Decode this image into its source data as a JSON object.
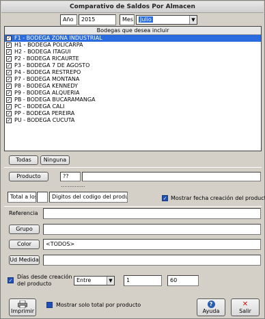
{
  "window": {
    "title": "Comparativo de Saldos Por Almacen"
  },
  "period": {
    "year_label": "Año",
    "year_value": "2015",
    "month_label": "Mes",
    "month_value": "Julio"
  },
  "warehouses": {
    "header": "Bodegas que desea incluir",
    "items": [
      {
        "label": "F1 - BODEGA ZONA INDUSTRIAL",
        "checked": true,
        "selected": true
      },
      {
        "label": "H1 - BODEGA POLICARPA",
        "checked": true
      },
      {
        "label": "H2 - BODEGA ITAGUI",
        "checked": true
      },
      {
        "label": "P2 - BODEGA RICAURTE",
        "checked": true
      },
      {
        "label": "P3 - BODEGA 7 DE AGOSTO",
        "checked": true
      },
      {
        "label": "P4 - BODEGA RESTREPO",
        "checked": true
      },
      {
        "label": "P7 - BODEGA MONTANA",
        "checked": true
      },
      {
        "label": "P8 - BODEGA KENNEDY",
        "checked": true
      },
      {
        "label": "P9 - BODEGA ALQUERIA",
        "checked": true
      },
      {
        "label": "PB - BODEGA BUCARAMANGA",
        "checked": true
      },
      {
        "label": "PC - BODEGA CALI",
        "checked": true
      },
      {
        "label": "PP - BODEGA PEREIRA",
        "checked": true
      },
      {
        "label": "PU - BODEGA CUCUTA",
        "checked": true
      }
    ],
    "all_button": "Todas",
    "none_button": "Ninguna"
  },
  "product": {
    "button": "Producto",
    "code_value": "??",
    "name_value": "",
    "dotted": ".............."
  },
  "digits": {
    "label": "Total a los",
    "value": "",
    "hint": "Digitos del codigo del producto"
  },
  "show_creation_date": {
    "label": "Mostrar fecha creación del producto",
    "checked": true
  },
  "reference": {
    "label": "Referencia",
    "value": ""
  },
  "group": {
    "button": "Grupo",
    "value": ""
  },
  "color": {
    "button": "Color",
    "value": "<TODOS>"
  },
  "unit": {
    "button": "Ud Medida",
    "value": ""
  },
  "days": {
    "label_line1": "Días desde creación",
    "label_line2": "del producto",
    "checked": true,
    "operator": "Entre",
    "from": "1",
    "to": "60"
  },
  "footer": {
    "print_label": "Imprimir",
    "only_total_label": "Mostrar solo total por producto",
    "help_label": "Ayuda",
    "exit_label": "Salir"
  },
  "colors": {
    "selection": "#2a6be0",
    "checkbox": "#1f4fb4"
  }
}
